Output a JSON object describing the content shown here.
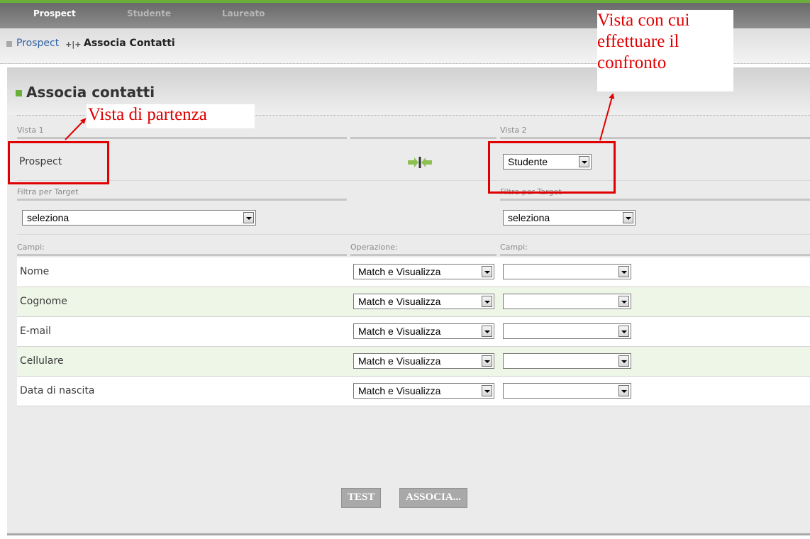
{
  "tabs": [
    {
      "label": "Prospect",
      "active": true
    },
    {
      "label": "Studente",
      "active": false
    },
    {
      "label": "Laureato",
      "active": false
    }
  ],
  "breadcrumb": {
    "link": "Prospect",
    "separator": "+|+",
    "current": "Associa Contatti"
  },
  "page_title": "Associa contatti",
  "vista1": {
    "label": "Vista 1",
    "value": "Prospect"
  },
  "vista2": {
    "label": "Vista 2",
    "value": "Studente"
  },
  "filter_left": {
    "label": "Filtra per Target",
    "value": "seleziona"
  },
  "filter_right": {
    "label": "Filtra per Target",
    "value": "seleziona"
  },
  "columns": {
    "campi_left": "Campi:",
    "operazione": "Operazione:",
    "campi_right": "Campi:"
  },
  "rows": [
    {
      "field": "Nome",
      "operation": "Match e Visualizza",
      "target": ""
    },
    {
      "field": "Cognome",
      "operation": "Match e Visualizza",
      "target": ""
    },
    {
      "field": "E-mail",
      "operation": "Match e Visualizza",
      "target": ""
    },
    {
      "field": "Cellulare",
      "operation": "Match e Visualizza",
      "target": ""
    },
    {
      "field": "Data di nascita",
      "operation": "Match e Visualizza",
      "target": ""
    }
  ],
  "buttons": {
    "test": "TEST",
    "associa": "ASSOCIA..."
  },
  "annotations": {
    "partenza": "Vista di partenza",
    "confronto": [
      "Vista con cui",
      "effettuare il",
      "confronto"
    ]
  },
  "icons": {
    "compare": "compare-arrows-icon"
  },
  "colors": {
    "accent_green": "#6aaf3a",
    "annotation_red": "#e00000"
  }
}
